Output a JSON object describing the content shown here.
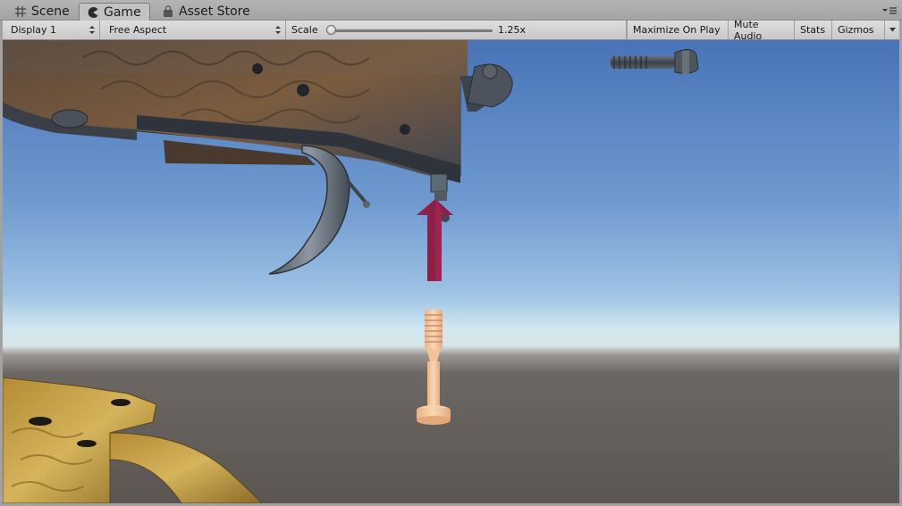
{
  "tabs": [
    {
      "label": "Scene",
      "icon": "grid-icon"
    },
    {
      "label": "Game",
      "icon": "pacman-icon"
    },
    {
      "label": "Asset Store",
      "icon": "bag-icon"
    }
  ],
  "toolbar": {
    "display": "Display 1",
    "aspect": "Free Aspect",
    "scale_label": "Scale",
    "scale_value": "1.25x",
    "maximize": "Maximize On Play",
    "mute": "Mute Audio",
    "stats": "Stats",
    "gizmos": "Gizmos"
  },
  "colors": {
    "sky_top": "#4a73b8",
    "horizon": "#c8e0ee",
    "ground": "#5e5956",
    "arrow": "#8e1f47",
    "ghost_screw": "#f1c49b"
  }
}
